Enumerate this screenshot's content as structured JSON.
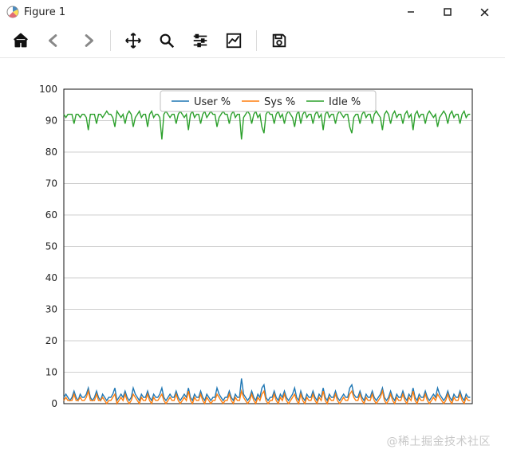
{
  "window": {
    "title": "Figure 1",
    "minimize": "Minimize",
    "maximize": "Maximize",
    "close": "Close"
  },
  "toolbar": {
    "home": "Home",
    "back": "Back",
    "forward": "Forward",
    "pan": "Pan",
    "zoom": "Zoom",
    "subplots": "Configure subplots",
    "axes": "Edit axis",
    "save": "Save"
  },
  "legend": {
    "user": "User %",
    "sys": "Sys %",
    "idle": "Idle %"
  },
  "watermark": "@稀土掘金技术社区",
  "chart_data": {
    "type": "line",
    "title": "",
    "xlabel": "",
    "ylabel": "",
    "xlim": [
      0,
      200
    ],
    "ylim": [
      0,
      100
    ],
    "yticks": [
      0,
      10,
      20,
      30,
      40,
      50,
      60,
      70,
      80,
      90,
      100
    ],
    "grid": true,
    "legend_position": "top-center",
    "x": [
      0,
      1,
      2,
      3,
      4,
      5,
      6,
      7,
      8,
      9,
      10,
      11,
      12,
      13,
      14,
      15,
      16,
      17,
      18,
      19,
      20,
      21,
      22,
      23,
      24,
      25,
      26,
      27,
      28,
      29,
      30,
      31,
      32,
      33,
      34,
      35,
      36,
      37,
      38,
      39,
      40,
      41,
      42,
      43,
      44,
      45,
      46,
      47,
      48,
      49,
      50,
      51,
      52,
      53,
      54,
      55,
      56,
      57,
      58,
      59,
      60,
      61,
      62,
      63,
      64,
      65,
      66,
      67,
      68,
      69,
      70,
      71,
      72,
      73,
      74,
      75,
      76,
      77,
      78,
      79,
      80,
      81,
      82,
      83,
      84,
      85,
      86,
      87,
      88,
      89,
      90,
      91,
      92,
      93,
      94,
      95,
      96,
      97,
      98,
      99,
      100,
      101,
      102,
      103,
      104,
      105,
      106,
      107,
      108,
      109,
      110,
      111,
      112,
      113,
      114,
      115,
      116,
      117,
      118,
      119,
      120,
      121,
      122,
      123,
      124,
      125,
      126,
      127,
      128,
      129,
      130,
      131,
      132,
      133,
      134,
      135,
      136,
      137,
      138,
      139,
      140,
      141,
      142,
      143,
      144,
      145,
      146,
      147,
      148,
      149,
      150,
      151,
      152,
      153,
      154,
      155,
      156,
      157,
      158,
      159,
      160,
      161,
      162,
      163,
      164,
      165,
      166,
      167,
      168,
      169,
      170,
      171,
      172,
      173,
      174,
      175,
      176,
      177,
      178,
      179,
      180,
      181,
      182,
      183,
      184,
      185,
      186,
      187,
      188,
      189,
      190,
      191,
      192,
      193,
      194,
      195,
      196,
      197,
      198,
      199
    ],
    "series": [
      {
        "name": "User %",
        "color": "#1f77b4",
        "values": [
          2,
          3,
          2,
          1,
          2,
          4,
          2,
          1,
          3,
          2,
          2,
          3,
          5,
          2,
          1,
          2,
          4,
          2,
          1,
          3,
          2,
          1,
          2,
          2,
          3,
          5,
          1,
          2,
          3,
          2,
          4,
          2,
          1,
          2,
          5,
          3,
          2,
          1,
          3,
          2,
          2,
          4,
          2,
          1,
          3,
          2,
          2,
          3,
          5,
          2,
          1,
          2,
          3,
          2,
          2,
          4,
          2,
          1,
          2,
          3,
          2,
          5,
          2,
          1,
          3,
          2,
          2,
          4,
          2,
          1,
          3,
          2,
          1,
          2,
          2,
          5,
          3,
          2,
          1,
          2,
          2,
          4,
          2,
          1,
          3,
          2,
          2,
          8,
          3,
          2,
          1,
          2,
          4,
          2,
          1,
          3,
          2,
          5,
          6,
          2,
          1,
          2,
          2,
          4,
          2,
          1,
          3,
          2,
          4,
          2,
          1,
          2,
          3,
          5,
          2,
          1,
          4,
          2,
          1,
          3,
          2,
          2,
          4,
          2,
          1,
          3,
          2,
          5,
          2,
          1,
          3,
          2,
          2,
          4,
          2,
          1,
          2,
          3,
          2,
          2,
          5,
          6,
          3,
          2,
          2,
          4,
          2,
          1,
          3,
          2,
          2,
          4,
          2,
          1,
          2,
          3,
          5,
          2,
          1,
          2,
          4,
          2,
          1,
          3,
          2,
          2,
          4,
          2,
          1,
          3,
          2,
          5,
          2,
          1,
          3,
          2,
          2,
          4,
          2,
          1,
          2,
          3,
          2,
          5,
          3,
          2,
          1,
          2,
          4,
          2,
          1,
          3,
          2,
          2,
          4,
          2,
          1,
          3,
          2,
          2
        ]
      },
      {
        "name": "Sys %",
        "color": "#ff7f0e",
        "values": [
          1,
          2,
          1,
          1,
          1,
          3,
          1,
          1,
          2,
          1,
          1,
          2,
          4,
          1,
          1,
          1,
          3,
          1,
          1,
          2,
          1,
          0,
          1,
          1,
          2,
          3,
          0,
          1,
          2,
          1,
          3,
          1,
          0,
          1,
          3,
          2,
          1,
          0,
          2,
          1,
          1,
          3,
          1,
          0,
          2,
          1,
          1,
          2,
          3,
          1,
          0,
          1,
          2,
          1,
          1,
          3,
          1,
          0,
          1,
          2,
          1,
          4,
          1,
          0,
          2,
          1,
          1,
          3,
          1,
          0,
          2,
          1,
          0,
          1,
          1,
          3,
          2,
          1,
          0,
          1,
          1,
          3,
          1,
          0,
          2,
          1,
          1,
          4,
          2,
          1,
          0,
          1,
          3,
          1,
          0,
          2,
          1,
          3,
          4,
          1,
          0,
          1,
          1,
          3,
          1,
          0,
          2,
          1,
          3,
          1,
          0,
          1,
          2,
          3,
          1,
          0,
          3,
          1,
          0,
          2,
          1,
          1,
          3,
          1,
          0,
          2,
          1,
          4,
          1,
          0,
          2,
          1,
          1,
          3,
          1,
          0,
          1,
          2,
          1,
          1,
          3,
          4,
          2,
          1,
          1,
          3,
          1,
          0,
          2,
          1,
          1,
          3,
          1,
          0,
          1,
          2,
          4,
          1,
          0,
          1,
          3,
          1,
          0,
          2,
          1,
          1,
          3,
          1,
          0,
          2,
          1,
          4,
          1,
          0,
          2,
          1,
          1,
          3,
          1,
          0,
          1,
          2,
          1,
          3,
          2,
          1,
          0,
          1,
          3,
          1,
          0,
          2,
          1,
          1,
          3,
          1,
          0,
          2,
          1,
          1
        ]
      },
      {
        "name": "Idle %",
        "color": "#2ca02c",
        "values": [
          92,
          91,
          92,
          92,
          92,
          89,
          92,
          92,
          91,
          92,
          92,
          91,
          87,
          92,
          92,
          92,
          89,
          92,
          92,
          91,
          92,
          93,
          92,
          92,
          91,
          88,
          93,
          92,
          91,
          92,
          89,
          92,
          93,
          92,
          88,
          91,
          92,
          93,
          91,
          92,
          92,
          88,
          92,
          93,
          91,
          92,
          92,
          91,
          84,
          92,
          93,
          92,
          91,
          92,
          92,
          89,
          92,
          93,
          92,
          91,
          92,
          87,
          92,
          93,
          91,
          92,
          92,
          89,
          92,
          93,
          91,
          92,
          93,
          92,
          92,
          88,
          91,
          92,
          93,
          92,
          92,
          89,
          92,
          93,
          91,
          92,
          92,
          84,
          91,
          92,
          93,
          92,
          89,
          92,
          93,
          91,
          92,
          88,
          86,
          92,
          93,
          92,
          92,
          89,
          92,
          93,
          91,
          92,
          89,
          92,
          93,
          92,
          91,
          88,
          92,
          93,
          89,
          92,
          93,
          91,
          92,
          92,
          89,
          92,
          93,
          91,
          92,
          87,
          92,
          93,
          91,
          92,
          92,
          89,
          92,
          93,
          92,
          91,
          92,
          92,
          88,
          86,
          91,
          92,
          92,
          89,
          92,
          93,
          91,
          92,
          92,
          89,
          92,
          93,
          92,
          91,
          87,
          92,
          93,
          92,
          89,
          92,
          93,
          91,
          92,
          92,
          89,
          92,
          93,
          91,
          92,
          87,
          92,
          93,
          91,
          92,
          92,
          89,
          92,
          93,
          92,
          91,
          92,
          88,
          91,
          92,
          93,
          92,
          89,
          92,
          93,
          91,
          92,
          92,
          89,
          92,
          93,
          91,
          92,
          92
        ]
      }
    ]
  }
}
